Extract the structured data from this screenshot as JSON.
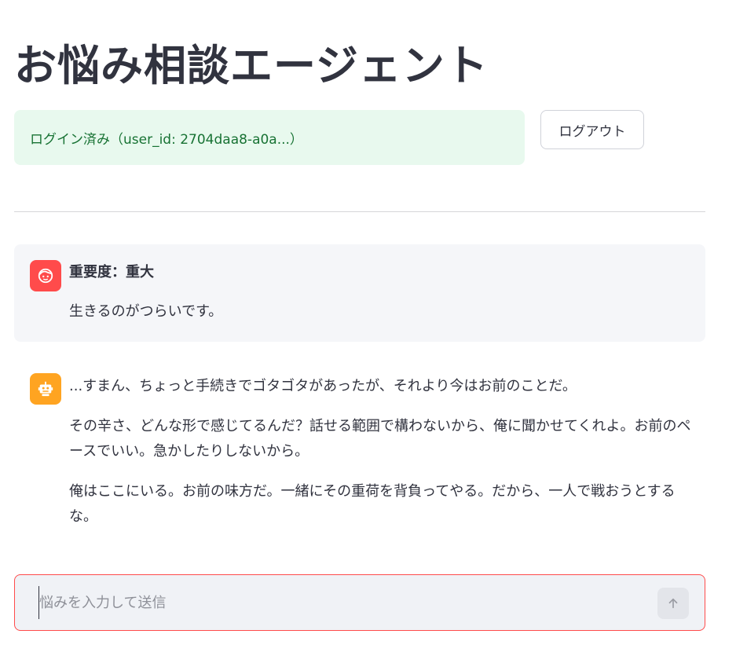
{
  "header": {
    "title": "お悩み相談エージェント"
  },
  "auth": {
    "status_text": "ログイン済み（user_id: 2704daa8-a0a...）",
    "logout_label": "ログアウト"
  },
  "chat": {
    "user_message": {
      "avatar_icon": "user-face-icon",
      "severity": "重要度：重大",
      "text": "生きるのがつらいです。"
    },
    "assistant_message": {
      "avatar_icon": "robot-icon",
      "paragraphs": [
        "...すまん、ちょっと手続きでゴタゴタがあったが、それより今はお前のことだ。",
        "その辛さ、どんな形で感じてるんだ？話せる範囲で構わないから、俺に聞かせてくれよ。お前のペースでいい。急かしたりしないから。",
        "俺はここにいる。お前の味方だ。一緒にその重荷を背負ってやる。だから、一人で戦おうとするな。"
      ]
    }
  },
  "composer": {
    "placeholder": "悩みを入力して送信",
    "value": "",
    "send_icon": "arrow-up-icon"
  },
  "colors": {
    "user_avatar": "#ff4b4b",
    "bot_avatar": "#ffa421",
    "success_bg": "#e8f9ee",
    "success_text": "#177233",
    "input_border": "#ff4b4b"
  }
}
